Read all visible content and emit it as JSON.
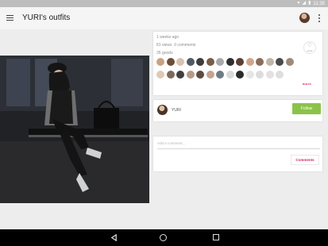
{
  "status_bar": {
    "time": "11:35",
    "wifi_icon": "wifi-icon",
    "signal_icon": "signal-icon",
    "battery_icon": "battery-icon"
  },
  "app_bar": {
    "title": "YURI's outfits",
    "menu_icon": "hamburger-menu-icon",
    "more_icon": "more-vert-icon"
  },
  "post": {
    "time_ago": "1 weeks ago",
    "views": "81 views",
    "comments_count": "0 comments",
    "goods_count": "35 goods",
    "good_label": "good",
    "more_label": "more",
    "liker_colors": [
      [
        "#c9a27e",
        "#6b4f3a",
        "#d8c3b0",
        "#4e5a66",
        "#3c3c3c",
        "#7a5c4a",
        "#a9a9a9",
        "#2f2f2f",
        "#5a4033",
        "#d2a58a",
        "#8a6c5a",
        "#c1b4a8",
        "#4a4a4a",
        "#9b8b7b"
      ],
      [
        "#e0c8b8",
        "#7c6a5c",
        "#3f3f3f",
        "#b89a86",
        "#5e4b3f",
        "#c7a48f",
        "#6e7b85",
        "#d9d9d9",
        "#2b2b2b",
        "#e5e5e5",
        "#dcdcdc",
        "#e2e2e2",
        "#dedede"
      ]
    ]
  },
  "owner": {
    "name": "YURI",
    "follow_label": "Follow"
  },
  "comment": {
    "placeholder": "Add a comment...",
    "button_label": "Comments"
  },
  "nav": {
    "back_icon": "back-icon",
    "home_icon": "home-icon",
    "recents_icon": "recents-icon"
  }
}
